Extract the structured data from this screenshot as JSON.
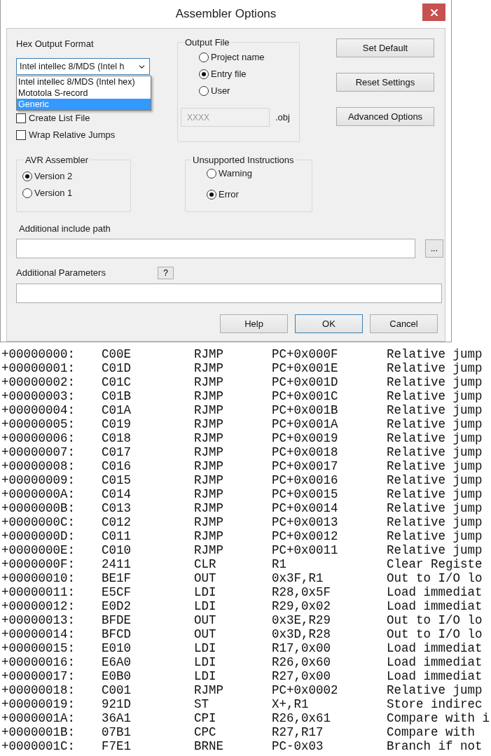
{
  "window": {
    "title": "Assembler Options"
  },
  "hex_output_format": {
    "label": "Hex Output Format",
    "value": "Intel intellec 8/MDS (Intel h",
    "expanded": true,
    "options": [
      {
        "label": "Intel intellec 8/MDS (Intel hex)",
        "selected": false
      },
      {
        "label": "Mototola S-record",
        "selected": false
      },
      {
        "label": "Generic",
        "selected": true
      }
    ]
  },
  "checkboxes": [
    {
      "label": "Create List File",
      "checked": false
    },
    {
      "label": "Wrap Relative Jumps",
      "checked": false
    }
  ],
  "output_file": {
    "title": "Output File",
    "options": [
      {
        "label": "Project name",
        "selected": false
      },
      {
        "label": "Entry file",
        "selected": true
      },
      {
        "label": "User",
        "selected": false
      }
    ],
    "field": {
      "value": "XXXX",
      "disabled": true
    },
    "extension": ".obj"
  },
  "side_buttons": [
    "Set Default",
    "Reset Settings",
    "Advanced Options"
  ],
  "avr_assembler": {
    "title": "AVR Assembler",
    "options": [
      {
        "label": "Version 2",
        "selected": true
      },
      {
        "label": "Version 1",
        "selected": false
      }
    ]
  },
  "unsupported_instructions": {
    "title": "Unsupported Instructions",
    "options": [
      {
        "label": "Warning",
        "selected": false
      },
      {
        "label": "Error",
        "selected": true
      }
    ]
  },
  "include_path": {
    "label": "Additional include path",
    "browse_button": "..."
  },
  "additional_parameters": {
    "label": "Additional Parameters",
    "help_button": "?"
  },
  "footer_buttons": [
    {
      "label": "Help",
      "default": false
    },
    {
      "label": "OK",
      "default": true
    },
    {
      "label": "Cancel",
      "default": false
    }
  ],
  "listing": {
    "rows": [
      {
        "address": "+00000000:",
        "opcode": "C00E",
        "mnemonic": "RJMP",
        "operands": "PC+0x000F",
        "comment": "Relative jump"
      },
      {
        "address": "+00000001:",
        "opcode": "C01D",
        "mnemonic": "RJMP",
        "operands": "PC+0x001E",
        "comment": "Relative jump"
      },
      {
        "address": "+00000002:",
        "opcode": "C01C",
        "mnemonic": "RJMP",
        "operands": "PC+0x001D",
        "comment": "Relative jump"
      },
      {
        "address": "+00000003:",
        "opcode": "C01B",
        "mnemonic": "RJMP",
        "operands": "PC+0x001C",
        "comment": "Relative jump"
      },
      {
        "address": "+00000004:",
        "opcode": "C01A",
        "mnemonic": "RJMP",
        "operands": "PC+0x001B",
        "comment": "Relative jump"
      },
      {
        "address": "+00000005:",
        "opcode": "C019",
        "mnemonic": "RJMP",
        "operands": "PC+0x001A",
        "comment": "Relative jump"
      },
      {
        "address": "+00000006:",
        "opcode": "C018",
        "mnemonic": "RJMP",
        "operands": "PC+0x0019",
        "comment": "Relative jump"
      },
      {
        "address": "+00000007:",
        "opcode": "C017",
        "mnemonic": "RJMP",
        "operands": "PC+0x0018",
        "comment": "Relative jump"
      },
      {
        "address": "+00000008:",
        "opcode": "C016",
        "mnemonic": "RJMP",
        "operands": "PC+0x0017",
        "comment": "Relative jump"
      },
      {
        "address": "+00000009:",
        "opcode": "C015",
        "mnemonic": "RJMP",
        "operands": "PC+0x0016",
        "comment": "Relative jump"
      },
      {
        "address": "+0000000A:",
        "opcode": "C014",
        "mnemonic": "RJMP",
        "operands": "PC+0x0015",
        "comment": "Relative jump"
      },
      {
        "address": "+0000000B:",
        "opcode": "C013",
        "mnemonic": "RJMP",
        "operands": "PC+0x0014",
        "comment": "Relative jump"
      },
      {
        "address": "+0000000C:",
        "opcode": "C012",
        "mnemonic": "RJMP",
        "operands": "PC+0x0013",
        "comment": "Relative jump"
      },
      {
        "address": "+0000000D:",
        "opcode": "C011",
        "mnemonic": "RJMP",
        "operands": "PC+0x0012",
        "comment": "Relative jump"
      },
      {
        "address": "+0000000E:",
        "opcode": "C010",
        "mnemonic": "RJMP",
        "operands": "PC+0x0011",
        "comment": "Relative jump"
      },
      {
        "address": "+0000000F:",
        "opcode": "2411",
        "mnemonic": "CLR",
        "operands": "R1",
        "comment": "Clear Registe"
      },
      {
        "address": "+00000010:",
        "opcode": "BE1F",
        "mnemonic": "OUT",
        "operands": "0x3F,R1",
        "comment": "Out to I/O lo"
      },
      {
        "address": "+00000011:",
        "opcode": "E5CF",
        "mnemonic": "LDI",
        "operands": "R28,0x5F",
        "comment": "Load immediat"
      },
      {
        "address": "+00000012:",
        "opcode": "E0D2",
        "mnemonic": "LDI",
        "operands": "R29,0x02",
        "comment": "Load immediat"
      },
      {
        "address": "+00000013:",
        "opcode": "BFDE",
        "mnemonic": "OUT",
        "operands": "0x3E,R29",
        "comment": "Out to I/O lo"
      },
      {
        "address": "+00000014:",
        "opcode": "BFCD",
        "mnemonic": "OUT",
        "operands": "0x3D,R28",
        "comment": "Out to I/O lo"
      },
      {
        "address": "+00000015:",
        "opcode": "E010",
        "mnemonic": "LDI",
        "operands": "R17,0x00",
        "comment": "Load immediat"
      },
      {
        "address": "+00000016:",
        "opcode": "E6A0",
        "mnemonic": "LDI",
        "operands": "R26,0x60",
        "comment": "Load immediat"
      },
      {
        "address": "+00000017:",
        "opcode": "E0B0",
        "mnemonic": "LDI",
        "operands": "R27,0x00",
        "comment": "Load immediat"
      },
      {
        "address": "+00000018:",
        "opcode": "C001",
        "mnemonic": "RJMP",
        "operands": "PC+0x0002",
        "comment": "Relative jump"
      },
      {
        "address": "+00000019:",
        "opcode": "921D",
        "mnemonic": "ST",
        "operands": "X+,R1",
        "comment": "Store indirec"
      },
      {
        "address": "+0000001A:",
        "opcode": "36A1",
        "mnemonic": "CPI",
        "operands": "R26,0x61",
        "comment": "Compare with i"
      },
      {
        "address": "+0000001B:",
        "opcode": "07B1",
        "mnemonic": "CPC",
        "operands": "R27,R17",
        "comment": "Compare with"
      },
      {
        "address": "+0000001C:",
        "opcode": "F7E1",
        "mnemonic": "BRNE",
        "operands": "PC-0x03",
        "comment": "Branch if not"
      }
    ]
  }
}
